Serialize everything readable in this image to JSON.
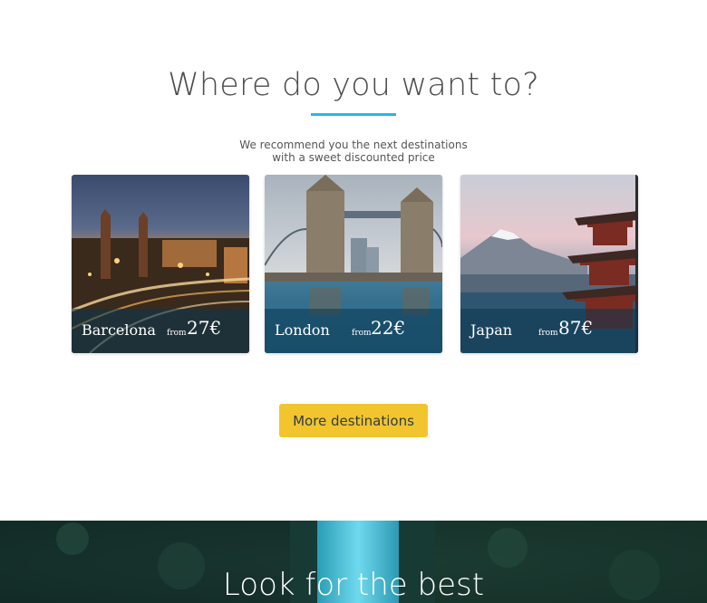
{
  "destinations_section": {
    "title": "Where do you want to?",
    "subtitle_line1": "We recommend you the next destinations",
    "subtitle_line2": "with a sweet discounted price",
    "cards": [
      {
        "city": "Barcelona",
        "from_label": "from",
        "price": "27€"
      },
      {
        "city": "London",
        "from_label": "from",
        "price": "22€"
      },
      {
        "city": "Japan",
        "from_label": "from",
        "price": "87€"
      }
    ],
    "more_button_label": "More destinations"
  },
  "hero_section": {
    "title": "Look for the best"
  },
  "colors": {
    "accent_underline": "#27b7e6",
    "button_bg": "#f2c52e",
    "card_overlay": "#0a3750"
  }
}
